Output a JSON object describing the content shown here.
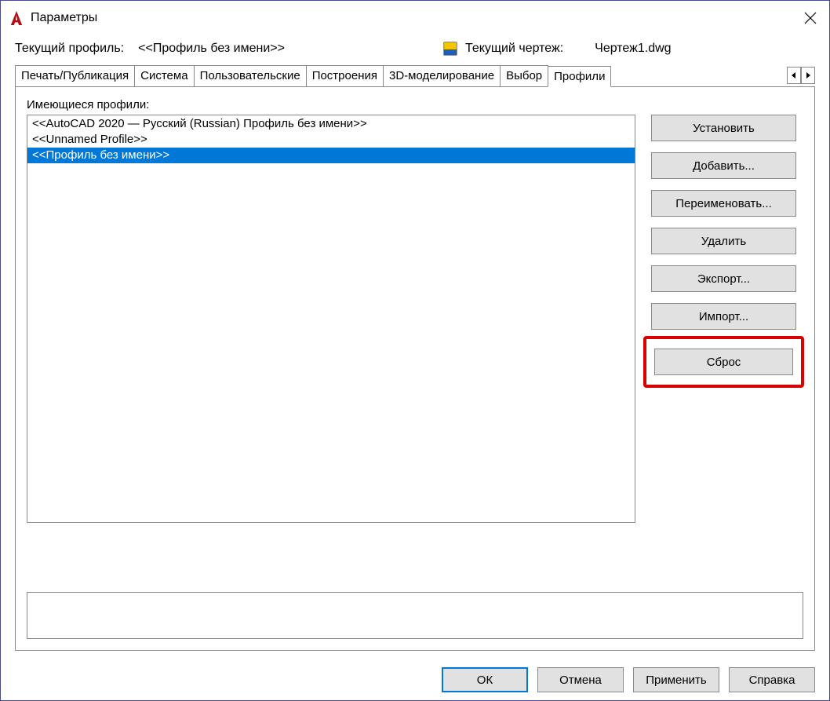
{
  "window": {
    "title": "Параметры"
  },
  "info": {
    "current_profile_label": "Текущий профиль:",
    "current_profile_value": "<<Профиль без имени>>",
    "current_drawing_label": "Текущий чертеж:",
    "current_drawing_value": "Чертеж1.dwg"
  },
  "tabs": [
    {
      "label": "Печать/Публикация"
    },
    {
      "label": "Система"
    },
    {
      "label": "Пользовательские"
    },
    {
      "label": "Построения"
    },
    {
      "label": "3D-моделирование"
    },
    {
      "label": "Выбор"
    },
    {
      "label": "Профили"
    }
  ],
  "profiles": {
    "list_label": "Имеющиеся профили:",
    "items": [
      {
        "name": "<<AutoCAD 2020 — Русский (Russian) Профиль без имени>>",
        "selected": false
      },
      {
        "name": "<<Unnamed Profile>>",
        "selected": false
      },
      {
        "name": "<<Профиль без имени>>",
        "selected": true
      }
    ]
  },
  "buttons": {
    "set_current": "Установить",
    "add": "Добавить...",
    "rename": "Переименовать...",
    "delete": "Удалить",
    "export": "Экспорт...",
    "import": "Импорт...",
    "reset": "Сброс"
  },
  "footer": {
    "ok": "ОК",
    "cancel": "Отмена",
    "apply": "Применить",
    "help": "Справка"
  }
}
